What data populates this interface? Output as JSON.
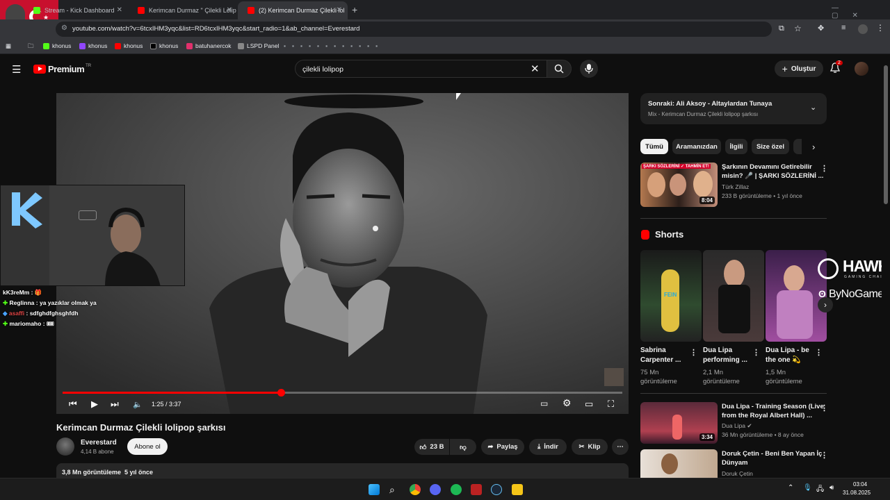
{
  "browser": {
    "tabs": [
      {
        "label": "Stream - Kick Dashboard"
      },
      {
        "label": "Kerimcan Durmaz \" Çilekli Lolip"
      },
      {
        "label": "(2) Kerimcan Durmaz Çilekli lol"
      }
    ],
    "url": "youtube.com/watch?v=6tcxIHM3yqc&list=RD6tcxIHM3yqc&start_radio=1&ab_channel=Everestard",
    "bookmarks": [
      "khonus",
      "khonus",
      "khonus",
      "khonus",
      "batuhanercok",
      "LSPD Panel"
    ]
  },
  "youtube": {
    "logo": "Premium",
    "logo_sup": "TR",
    "search_value": "çilekli lolipop",
    "create_label": "Oluştur",
    "notif_count": "2"
  },
  "player": {
    "time": "1:25 / 3:37",
    "progress": 0.39
  },
  "video": {
    "title": "Kerimcan Durmaz Çilekli lolipop şarkısı",
    "channel": "Everestard",
    "subs": "4,14 B abone",
    "subscribe": "Abone ol",
    "likes": "23 B",
    "share": "Paylaş",
    "download": "İndir",
    "clip": "Klip",
    "views_line": "3,8 Mn görüntüleme  5 yıl önce"
  },
  "upnext": {
    "title": "Sonraki: Ali Aksoy - Altaylardan Tunaya",
    "subtitle": "Mix - Kerimcan Durmaz Çilekli lolipop şarkısı"
  },
  "chips": [
    "Tümü",
    "Aramanızdan",
    "İlgili",
    "Size özel"
  ],
  "related": [
    {
      "title1": "Şarkının Devamını Getirebilir",
      "title2": "misin? 🎤 | ŞARKI SÖZLERİNİ ...",
      "channel": "Türk Zillaz",
      "meta": "233 B görüntüleme • 1 yıl önce",
      "duration": "8:04",
      "thumb_text": "ŞARKI SÖZLERİNİ ✓ TAHMİN ET!"
    }
  ],
  "shorts": {
    "heading": "Shorts",
    "items": [
      {
        "title1": "Sabrina",
        "title2": "Carpenter ...",
        "v1": "75 Mn",
        "v2": "görüntüleme"
      },
      {
        "title1": "Dua Lipa",
        "title2": "performing ...",
        "v1": "2,1 Mn",
        "v2": "görüntüleme"
      },
      {
        "title1": "Dua Lipa - be",
        "title2": "the one 💫",
        "v1": "1,5 Mn",
        "v2": "görüntüleme"
      }
    ]
  },
  "related2": [
    {
      "title1": "Dua Lipa - Training Season (Live",
      "title2": "from the Royal Albert Hall) ...",
      "channel": "Dua Lipa",
      "meta": "36 Mn görüntüleme • 8 ay önce",
      "duration": "3:34"
    },
    {
      "title1": "Doruk Çetin - Beni Ben Yapan İç",
      "title2": "Dünyam",
      "channel": "Doruk Çetin"
    }
  ],
  "chat": [
    {
      "user": "kK3reMm",
      "text": ": 🎁"
    },
    {
      "user": "Reglinna",
      "text": ": ya yazıklar olmak ya"
    },
    {
      "user": "asaffi",
      "text": ": sdfghdfghsghfdh"
    },
    {
      "user": "mariomaho",
      "text": ": 🎟"
    }
  ],
  "sponsor": {
    "brand1": "HAWK",
    "brand1_sub": "GAMING CHAIR",
    "brand2": "ByNoGame"
  },
  "clock": {
    "time": "03:04",
    "date": "31.08.2025"
  },
  "colors": {
    "accent": "#ff0000",
    "bg": "#0f0f0f",
    "kick": "#53fc18"
  }
}
